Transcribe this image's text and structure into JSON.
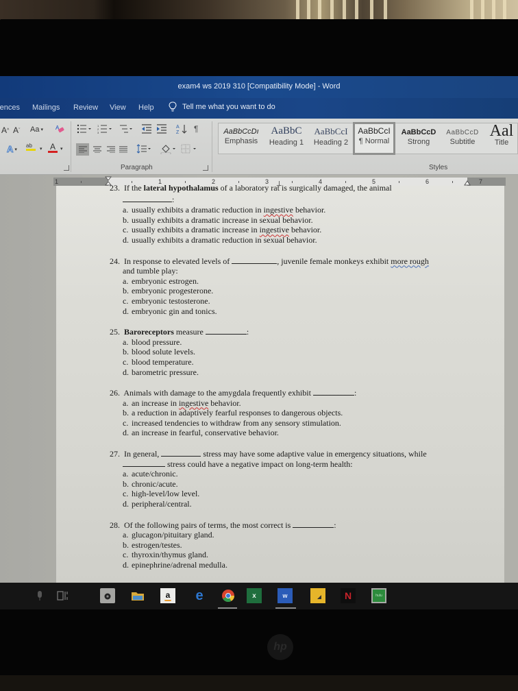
{
  "window": {
    "title": "exam4 ws 2019 310 [Compatibility Mode]  -  Word"
  },
  "ribbon_tabs": [
    {
      "label": "rences"
    },
    {
      "label": "Mailings"
    },
    {
      "label": "Review"
    },
    {
      "label": "View"
    },
    {
      "label": "Help"
    }
  ],
  "tell_me": {
    "placeholder": "Tell me what you want to do"
  },
  "font_group": {
    "grow_font": "A",
    "shrink_font": "A",
    "change_case": "Aa",
    "text_effects": "A",
    "highlight": "ab",
    "font_color": "A",
    "highlight_color": "#e8d400",
    "font_color_bar": "#d42020"
  },
  "paragraph_group": {
    "label": "Paragraph"
  },
  "styles_group": {
    "label": "Styles",
    "items": [
      {
        "sample": "AaBbCcDı",
        "name": "Emphasis"
      },
      {
        "sample": "AaBbC",
        "name": "Heading 1"
      },
      {
        "sample": "AaBbCcI",
        "name": "Heading 2"
      },
      {
        "sample": "AaBbCcI",
        "name": "¶ Normal",
        "selected": true
      },
      {
        "sample": "AaBbCcD",
        "name": "Strong"
      },
      {
        "sample": "AaBbCcD",
        "name": "Subtitle"
      },
      {
        "sample": "Aal",
        "name": "Title"
      }
    ]
  },
  "ruler": {
    "labels": [
      "1",
      "1",
      "2",
      "3",
      "4",
      "5",
      "6",
      "7"
    ]
  },
  "questions": [
    {
      "number": "23.",
      "stem_parts": [
        {
          "text": "If the ",
          "bold": false
        },
        {
          "text": "lateral hypothalamus",
          "bold": true
        },
        {
          "text": " of a laboratory rat is surgically damaged, the animal",
          "bold": false
        }
      ],
      "blank_line_suffix": ":",
      "options": [
        {
          "letter": "a.",
          "text_before": "usually exhibits a dramatic reduction in ",
          "spell": "ingestive",
          "text_after": " behavior."
        },
        {
          "letter": "b.",
          "text_before": "usually exhibits a dramatic increase in sexual behavior.",
          "spell": "",
          "text_after": ""
        },
        {
          "letter": "c.",
          "text_before": "usually exhibits a dramatic increase in ",
          "spell": "ingestive",
          "text_after": " behavior."
        },
        {
          "letter": "d.",
          "text_before": "usually exhibits a dramatic reduction in sexual behavior.",
          "spell": "",
          "text_after": ""
        }
      ]
    },
    {
      "number": "24.",
      "stem_before": "In response to elevated levels of ",
      "stem_after": ", juvenile female monkeys exhibit ",
      "stem_spell": "more rough",
      "stem_line2": "and tumble play:",
      "options": [
        {
          "letter": "a.",
          "text": "embryonic estrogen."
        },
        {
          "letter": "b.",
          "text": "embryonic progesterone."
        },
        {
          "letter": "c.",
          "text": "embryonic testosterone."
        },
        {
          "letter": "d.",
          "text": "embryonic gin and tonics."
        }
      ]
    },
    {
      "number": "25.",
      "stem_bold": "Baroreceptors",
      "stem_after": " measure ",
      "stem_end": ":",
      "options": [
        {
          "letter": "a.",
          "text": "blood pressure."
        },
        {
          "letter": "b.",
          "text": "blood solute levels."
        },
        {
          "letter": "c.",
          "text": "blood temperature."
        },
        {
          "letter": "d.",
          "text": "barometric pressure."
        }
      ]
    },
    {
      "number": "26.",
      "stem": "Animals with damage to the amygdala frequently exhibit ",
      "stem_end": ":",
      "options": [
        {
          "letter": "a.",
          "text_before": "an increase in ",
          "spell": "ingestive",
          "text_after": " behavior."
        },
        {
          "letter": "b.",
          "text_before": "a reduction in adaptively fearful responses to dangerous objects.",
          "spell": "",
          "text_after": ""
        },
        {
          "letter": "c.",
          "text_before": "increased tendencies to withdraw from any sensory stimulation.",
          "spell": "",
          "text_after": ""
        },
        {
          "letter": "d.",
          "text_before": "an increase in fearful, conservative behavior.",
          "spell": "",
          "text_after": ""
        }
      ]
    },
    {
      "number": "27.",
      "stem_before": "In general, ",
      "stem_after": " stress may have some adaptive value in emergency situations, while",
      "stem_line2": " stress could have a negative impact on long-term health:",
      "options": [
        {
          "letter": "a.",
          "text": "acute/chronic."
        },
        {
          "letter": "b.",
          "text": "chronic/acute."
        },
        {
          "letter": "c.",
          "text": "high-level/low level."
        },
        {
          "letter": "d.",
          "text": "peripheral/central."
        }
      ]
    },
    {
      "number": "28.",
      "stem": "Of the following pairs of terms, the most correct is ",
      "stem_end": ":",
      "options": [
        {
          "letter": "a.",
          "text": "glucagon/pituitary gland."
        },
        {
          "letter": "b.",
          "text": "estrogen/testes."
        },
        {
          "letter": "c.",
          "text": "thyroxin/thymus gland."
        },
        {
          "letter": "d.",
          "text": "epinephrine/adrenal medulla."
        }
      ]
    }
  ],
  "taskbar": {
    "items": [
      {
        "name": "microphone",
        "glyph": "🎙"
      },
      {
        "name": "task-view",
        "glyph": "⧉"
      },
      {
        "name": "camera",
        "glyph": "◉"
      },
      {
        "name": "file-explorer",
        "glyph": "▬"
      },
      {
        "name": "amazon",
        "glyph": "a"
      },
      {
        "name": "edge",
        "glyph": "e"
      },
      {
        "name": "chrome",
        "glyph": "◍"
      },
      {
        "name": "excel",
        "glyph": "x"
      },
      {
        "name": "word",
        "glyph": "w"
      },
      {
        "name": "sticky-notes",
        "glyph": "◢"
      },
      {
        "name": "netflix",
        "glyph": "N"
      },
      {
        "name": "hulu",
        "glyph": "hulu"
      }
    ]
  },
  "monitor": {
    "brand": "hp"
  }
}
